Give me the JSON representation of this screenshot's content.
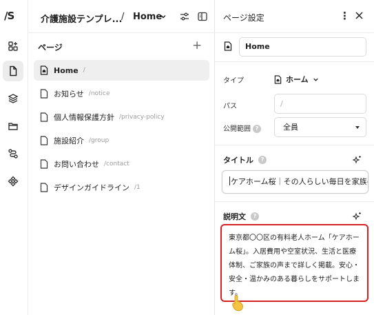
{
  "rail": {
    "logo": "/S",
    "items": [
      "pages-icon",
      "layers-icon",
      "folder-icon",
      "flow-icon",
      "components-icon",
      "apps-icon"
    ]
  },
  "header": {
    "site_title": "介護施設テンプレ...",
    "separator": "/",
    "current_page": "Home"
  },
  "pages_panel": {
    "heading": "ページ",
    "add_label": "+",
    "items": [
      {
        "name": "Home",
        "path": "/",
        "icon": "home-page-icon"
      },
      {
        "name": "お知らせ",
        "path": "/notice",
        "icon": "page-icon"
      },
      {
        "name": "個人情報保護方針",
        "path": "/privacy-policy",
        "icon": "page-icon"
      },
      {
        "name": "施設紹介",
        "path": "/group",
        "icon": "page-icon"
      },
      {
        "name": "お問い合わせ",
        "path": "/contact",
        "icon": "page-icon"
      },
      {
        "name": "デザインガイドライン",
        "path": "/1",
        "icon": "page-icon"
      }
    ]
  },
  "settings": {
    "title": "ページ設定",
    "more_label": "⋮",
    "page_name": "Home",
    "type_label": "タイプ",
    "type_value": "ホーム",
    "path_label": "パス",
    "path_placeholder": "/",
    "visibility_label": "公開範囲",
    "help_glyph": "?",
    "visibility_value": "全員",
    "seo_title_label": "タイトル",
    "seo_title_value": "ケアホーム桜｜その人らしい毎日を家族の",
    "description_label": "説明文",
    "description_value": "東京都〇〇区の有料老人ホーム「ケアホーム桜」。入居費用や空室状況、生活と医療体制、ご家族の声まで詳しく掲載。安心・安全・温かみのある暮らしをサポートします。"
  },
  "colors": {
    "highlight_border": "#d62020",
    "active_row": "#efefef",
    "cursor": "#f5c542"
  }
}
